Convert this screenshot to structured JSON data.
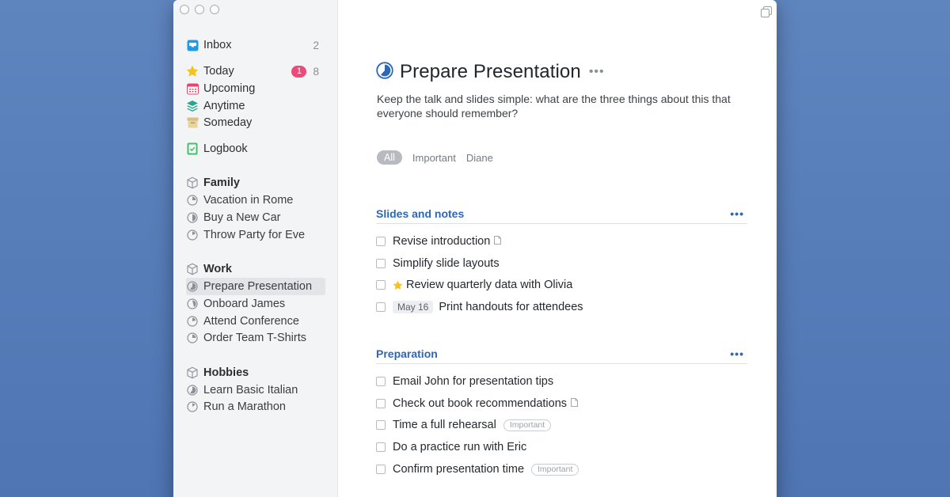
{
  "sidebar": {
    "inbox": {
      "label": "Inbox",
      "count": "2"
    },
    "today": {
      "label": "Today",
      "badge": "1",
      "count": "8"
    },
    "upcoming": {
      "label": "Upcoming"
    },
    "anytime": {
      "label": "Anytime"
    },
    "someday": {
      "label": "Someday"
    },
    "logbook": {
      "label": "Logbook"
    },
    "areas": [
      {
        "label": "Family",
        "projects": [
          "Vacation in Rome",
          "Buy a New Car",
          "Throw Party for Eve"
        ]
      },
      {
        "label": "Work",
        "projects": [
          "Prepare Presentation",
          "Onboard James",
          "Attend Conference",
          "Order Team T-Shirts"
        ]
      },
      {
        "label": "Hobbies",
        "projects": [
          "Learn Basic Italian",
          "Run a Marathon"
        ]
      }
    ]
  },
  "project": {
    "title": "Prepare Presentation",
    "more": "•••",
    "notes": "Keep the talk and slides simple: what are the three things about this that everyone should remember?"
  },
  "filters": [
    "All",
    "Important",
    "Diane"
  ],
  "sections": [
    {
      "heading": "Slides and notes",
      "more": "•••",
      "todos": [
        {
          "title": "Revise introduction"
        },
        {
          "title": "Simplify slide layouts"
        },
        {
          "title": "Review quarterly data with Olivia"
        },
        {
          "date": "May 16",
          "title": "Print handouts for attendees"
        }
      ]
    },
    {
      "heading": "Preparation",
      "more": "•••",
      "todos": [
        {
          "title": "Email John for presentation tips"
        },
        {
          "title": "Check out book recommendations"
        },
        {
          "title": "Time a full rehearsal",
          "tag": "Important"
        },
        {
          "title": "Do a practice run with Eric"
        },
        {
          "title": "Confirm presentation time",
          "tag": "Important"
        }
      ]
    }
  ],
  "colors": {
    "accent": "#2d67b6",
    "badge": "#f1487b",
    "background": "#5a80bc"
  }
}
